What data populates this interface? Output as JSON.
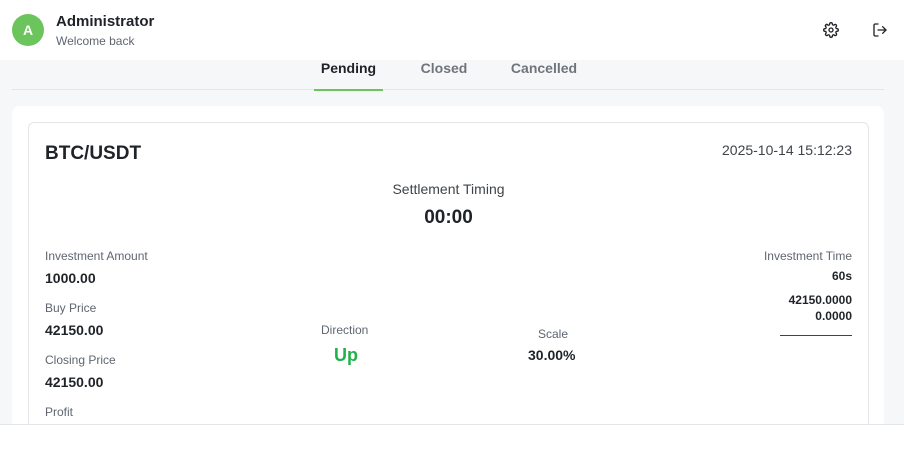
{
  "user": {
    "avatar_letter": "A",
    "name": "Administrator",
    "subtitle": "Welcome back"
  },
  "header_icons": [
    "gear-icon",
    "logout-icon"
  ],
  "tabs": [
    {
      "label": "Pending",
      "active": true
    },
    {
      "label": "Closed",
      "active": false
    },
    {
      "label": "Cancelled",
      "active": false
    }
  ],
  "order": {
    "pair": "BTC/USDT",
    "timestamp": "2025-10-14 15:12:23",
    "settlement_label": "Settlement Timing",
    "settlement_value": "00:00",
    "investment_amount_label": "Investment Amount",
    "investment_amount": "1000.00",
    "buy_price_label": "Buy Price",
    "buy_price": "42150.00",
    "closing_price_label": "Closing Price",
    "closing_price": "42150.00",
    "profit_label": "Profit",
    "direction_label": "Direction",
    "direction": "Up",
    "scale_label": "Scale",
    "scale": "30.00%",
    "investment_time_label": "Investment Time",
    "investment_time": "60s",
    "price_a": "42150.0000",
    "price_b": "0.0000"
  },
  "colors": {
    "accent": "#6cc45c",
    "up": "#22b14c"
  }
}
